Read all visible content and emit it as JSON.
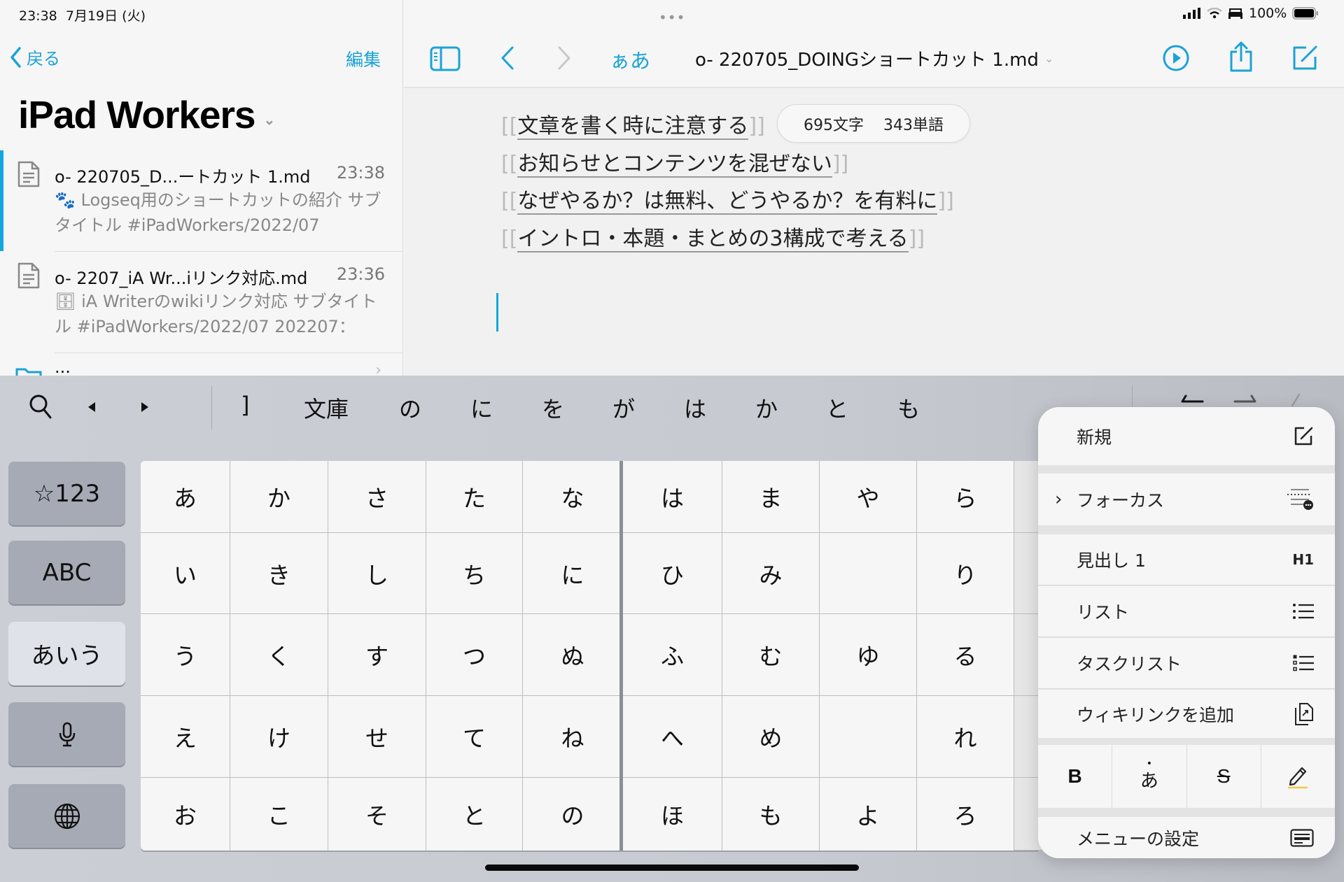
{
  "status_bar": {
    "time": "23:38",
    "date": "7月19日 (火)",
    "battery": "100%",
    "icons": [
      "cellular-signal-icon",
      "wifi-icon",
      "sleep-bed-icon",
      "battery-icon"
    ]
  },
  "sidebar": {
    "back_label": "戻る",
    "edit_label": "編集",
    "library_title": "iPad Workers",
    "files": [
      {
        "name": "o- 220705_D...ートカット 1.md",
        "time": "23:38",
        "preview_emoji": "🐾",
        "preview": "Logseq用のショートカットの紹介 サブタイトル #iPadWorkers/2022/07",
        "selected": true
      },
      {
        "name": "o- 2207_iA Wr...iリンク対応.md",
        "time": "23:36",
        "preview_emoji": "🗄",
        "preview": "iA Writerのwikiリンク対応 サブタイトル #iPadWorkers/2022/07 202207：",
        "selected": false
      }
    ],
    "folder_partial": "..."
  },
  "editor": {
    "multitask_dots": "•••",
    "font_button": "ぁあ",
    "doc_title": "o- 220705_DOINGショートカット 1.md",
    "lines": [
      "文章を書く時に注意する",
      "お知らせとコンテンツを混ぜない",
      "なぜやるか？は無料、どうやるか？を有料に",
      "イントロ・本題・まとめの3構成で考える"
    ],
    "bracket_open": "[[",
    "bracket_close": "]]",
    "char_count": "695文字",
    "word_count": "343単語"
  },
  "keyboard": {
    "suggestions": [
      "]",
      "文庫",
      "の",
      "に",
      "を",
      "が",
      "は",
      "か",
      "と",
      "も"
    ],
    "mode_keys": [
      "☆123",
      "ABC",
      "あいう",
      "mic",
      "globe"
    ],
    "active_mode": "あいう",
    "kana_columns": [
      [
        "あ",
        "い",
        "う",
        "え",
        "お"
      ],
      [
        "か",
        "き",
        "く",
        "け",
        "こ"
      ],
      [
        "さ",
        "し",
        "す",
        "せ",
        "そ"
      ],
      [
        "た",
        "ち",
        "つ",
        "て",
        "と"
      ],
      [
        "な",
        "に",
        "ぬ",
        "ね",
        "の"
      ],
      [
        "は",
        "ひ",
        "ふ",
        "へ",
        "ほ"
      ],
      [
        "ま",
        "み",
        "む",
        "め",
        "も"
      ],
      [
        "や",
        "",
        "ゆ",
        "",
        "よ"
      ],
      [
        "ら",
        "り",
        "る",
        "れ",
        "ろ"
      ]
    ]
  },
  "menu": {
    "items": [
      {
        "label": "新規",
        "icon": "compose-icon"
      },
      {
        "label": "フォーカス",
        "icon": "focus-icon",
        "submenu": true
      },
      {
        "label": "見出し 1",
        "icon_text": "H1"
      },
      {
        "label": "リスト",
        "icon": "bullet-list-icon"
      },
      {
        "label": "タスクリスト",
        "icon": "task-list-icon"
      },
      {
        "label": "ウィキリンクを追加",
        "icon": "wikilink-icon"
      },
      {
        "label": "メニューの設定",
        "icon": "menu-settings-icon"
      }
    ],
    "format_buttons": [
      {
        "label": "B",
        "name": "bold"
      },
      {
        "label": "あ",
        "name": "emphasis-dot"
      },
      {
        "label": "S",
        "name": "strikethrough"
      },
      {
        "label": "",
        "name": "highlight"
      }
    ],
    "highlight_color": "#f2c94c"
  },
  "colors": {
    "accent": "#1aa3d6",
    "selection_bar": "#12a7e0"
  }
}
